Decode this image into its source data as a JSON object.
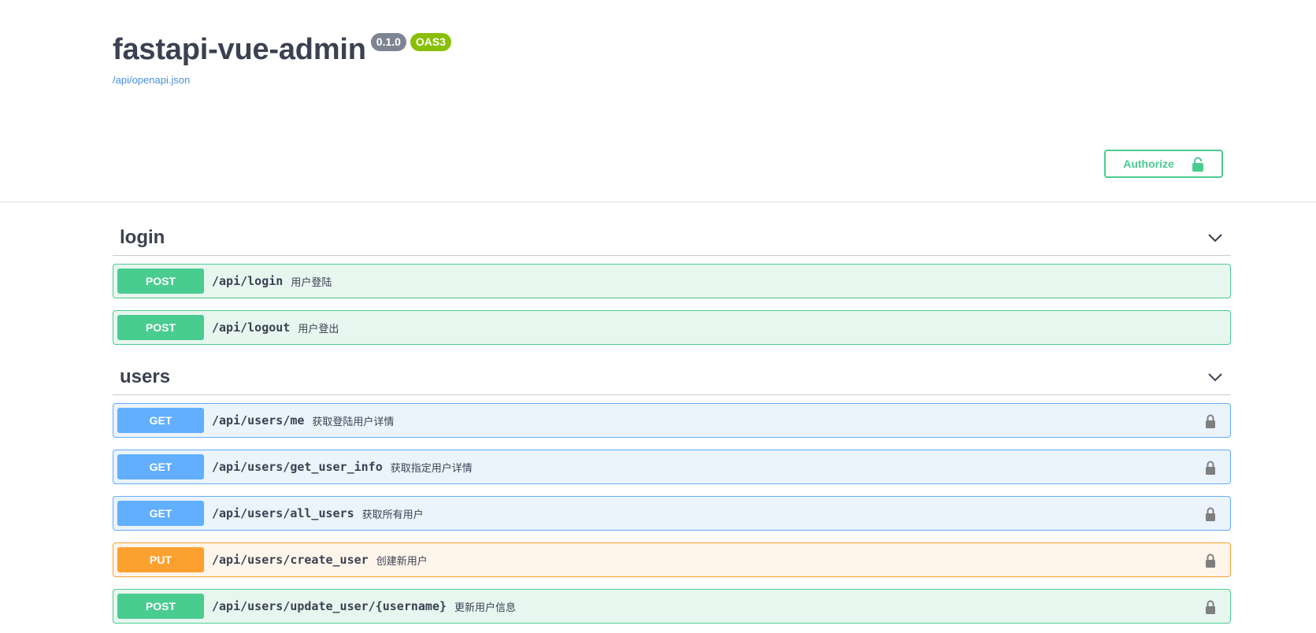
{
  "info": {
    "title": "fastapi-vue-admin",
    "version": "0.1.0",
    "oas": "OAS3",
    "spec_link": "/api/openapi.json"
  },
  "authorize": {
    "label": "Authorize"
  },
  "colors": {
    "post": "#49cc90",
    "get": "#61affe",
    "put": "#fca130"
  },
  "sections": [
    {
      "tag": "login",
      "operations": [
        {
          "method": "POST",
          "path": "/api/login",
          "summary": "用户登陆",
          "locked": false
        },
        {
          "method": "POST",
          "path": "/api/logout",
          "summary": "用户登出",
          "locked": false
        }
      ]
    },
    {
      "tag": "users",
      "operations": [
        {
          "method": "GET",
          "path": "/api/users/me",
          "summary": "获取登陆用户详情",
          "locked": true
        },
        {
          "method": "GET",
          "path": "/api/users/get_user_info",
          "summary": "获取指定用户详情",
          "locked": true
        },
        {
          "method": "GET",
          "path": "/api/users/all_users",
          "summary": "获取所有用户",
          "locked": true
        },
        {
          "method": "PUT",
          "path": "/api/users/create_user",
          "summary": "创建新用户",
          "locked": true
        },
        {
          "method": "POST",
          "path": "/api/users/update_user/{username}",
          "summary": "更新用户信息",
          "locked": true
        }
      ]
    }
  ]
}
